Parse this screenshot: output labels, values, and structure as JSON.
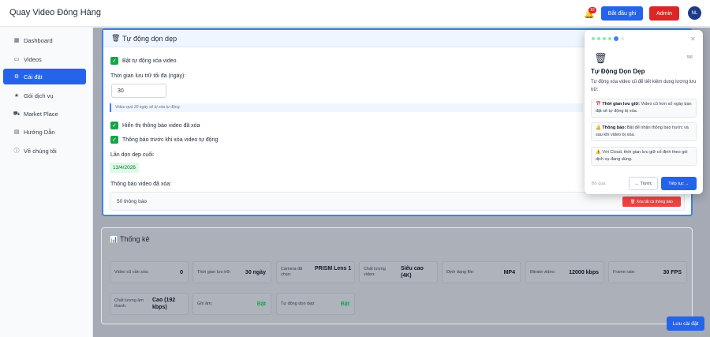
{
  "header": {
    "title": "Quay Video Đóng Hàng",
    "notif_count": "10",
    "record_label": "Bắt đầu ghi",
    "admin_label": "Admin",
    "avatar_initials": "NL"
  },
  "sidebar": {
    "items": [
      {
        "label": "Dashboard",
        "icon": "grid-icon"
      },
      {
        "label": "Videos",
        "icon": "video-icon"
      },
      {
        "label": "Cài đặt",
        "icon": "gear-icon",
        "active": true
      },
      {
        "label": "Gói dịch vụ",
        "icon": "star-icon"
      },
      {
        "label": "Market Place",
        "icon": "cart-icon"
      },
      {
        "label": "Hướng Dẫn",
        "icon": "book-icon"
      },
      {
        "label": "Về chúng tôi",
        "icon": "info-icon"
      }
    ]
  },
  "cleanup": {
    "title": "Tự động dọn dẹp",
    "auto_delete_label": "Bật tự động xóa video",
    "retention_label": "Thời gian lưu trữ tối đa (ngày):",
    "retention_value": "30",
    "retention_hint": "Video quá 30 ngày sẽ bị xóa tự động.",
    "show_deleted_label": "Hiển thị thông báo video đã xóa",
    "notify_before_label": "Thông báo trước khi xóa video tự động",
    "last_cleanup_label": "Lần dọn dẹp cuối:",
    "last_cleanup_date": "13/4/2026",
    "deleted_notif_label": "Thông báo video đã xóa:",
    "notif_count_text": "50 thông báo",
    "clear_button": "🗑 Xóa tất cả thông báo"
  },
  "stats": {
    "title": "Thống kê",
    "items": [
      {
        "key": "Video cũ cần xóa:",
        "value": "0"
      },
      {
        "key": "Thời gian lưu trữ:",
        "value": "30 ngày"
      },
      {
        "key": "Camera đã chọn:",
        "value": "PRISM Lens 1"
      },
      {
        "key": "Chất lượng video:",
        "value": "Siêu cao (4K)"
      },
      {
        "key": "Định dạng file:",
        "value": "MP4"
      },
      {
        "key": "Bitrate video:",
        "value": "12000 kbps"
      },
      {
        "key": "Frame rate:",
        "value": "30 FPS"
      },
      {
        "key": "Chất lượng âm thanh:",
        "value": "Cao (192 kbps)"
      },
      {
        "key": "Ghi âm:",
        "value": "Bật"
      },
      {
        "key": "Tự động dọn dẹp:",
        "value": "Bật"
      }
    ]
  },
  "save_button": "Lưu cài đặt",
  "tour": {
    "step": "5/6",
    "title": "Tự Động Dọn Dẹp",
    "desc": "Tự động xóa video cũ để tiết kiệm dung lượng lưu trữ:",
    "tips": [
      {
        "icon": "📅",
        "bold": "Thời gian lưu giữ:",
        "text": " Video cũ hơn số ngày bạn đặt sẽ tự động bị xóa."
      },
      {
        "icon": "🔔",
        "bold": "Thông báo:",
        "text": " Bật để nhận thông báo trước và sau khi video bị xóa."
      },
      {
        "icon": "⚠️",
        "bold": "",
        "text": "Với Cloud, thời gian lưu giữ cố định theo gói dịch vụ đang dùng."
      }
    ],
    "skip_label": "Bỏ qua",
    "prev_label": "← Trước",
    "next_label": "Tiếp tục →"
  },
  "colors": {
    "primary": "#2563eb",
    "danger": "#dc2626",
    "success": "#16a34a"
  }
}
